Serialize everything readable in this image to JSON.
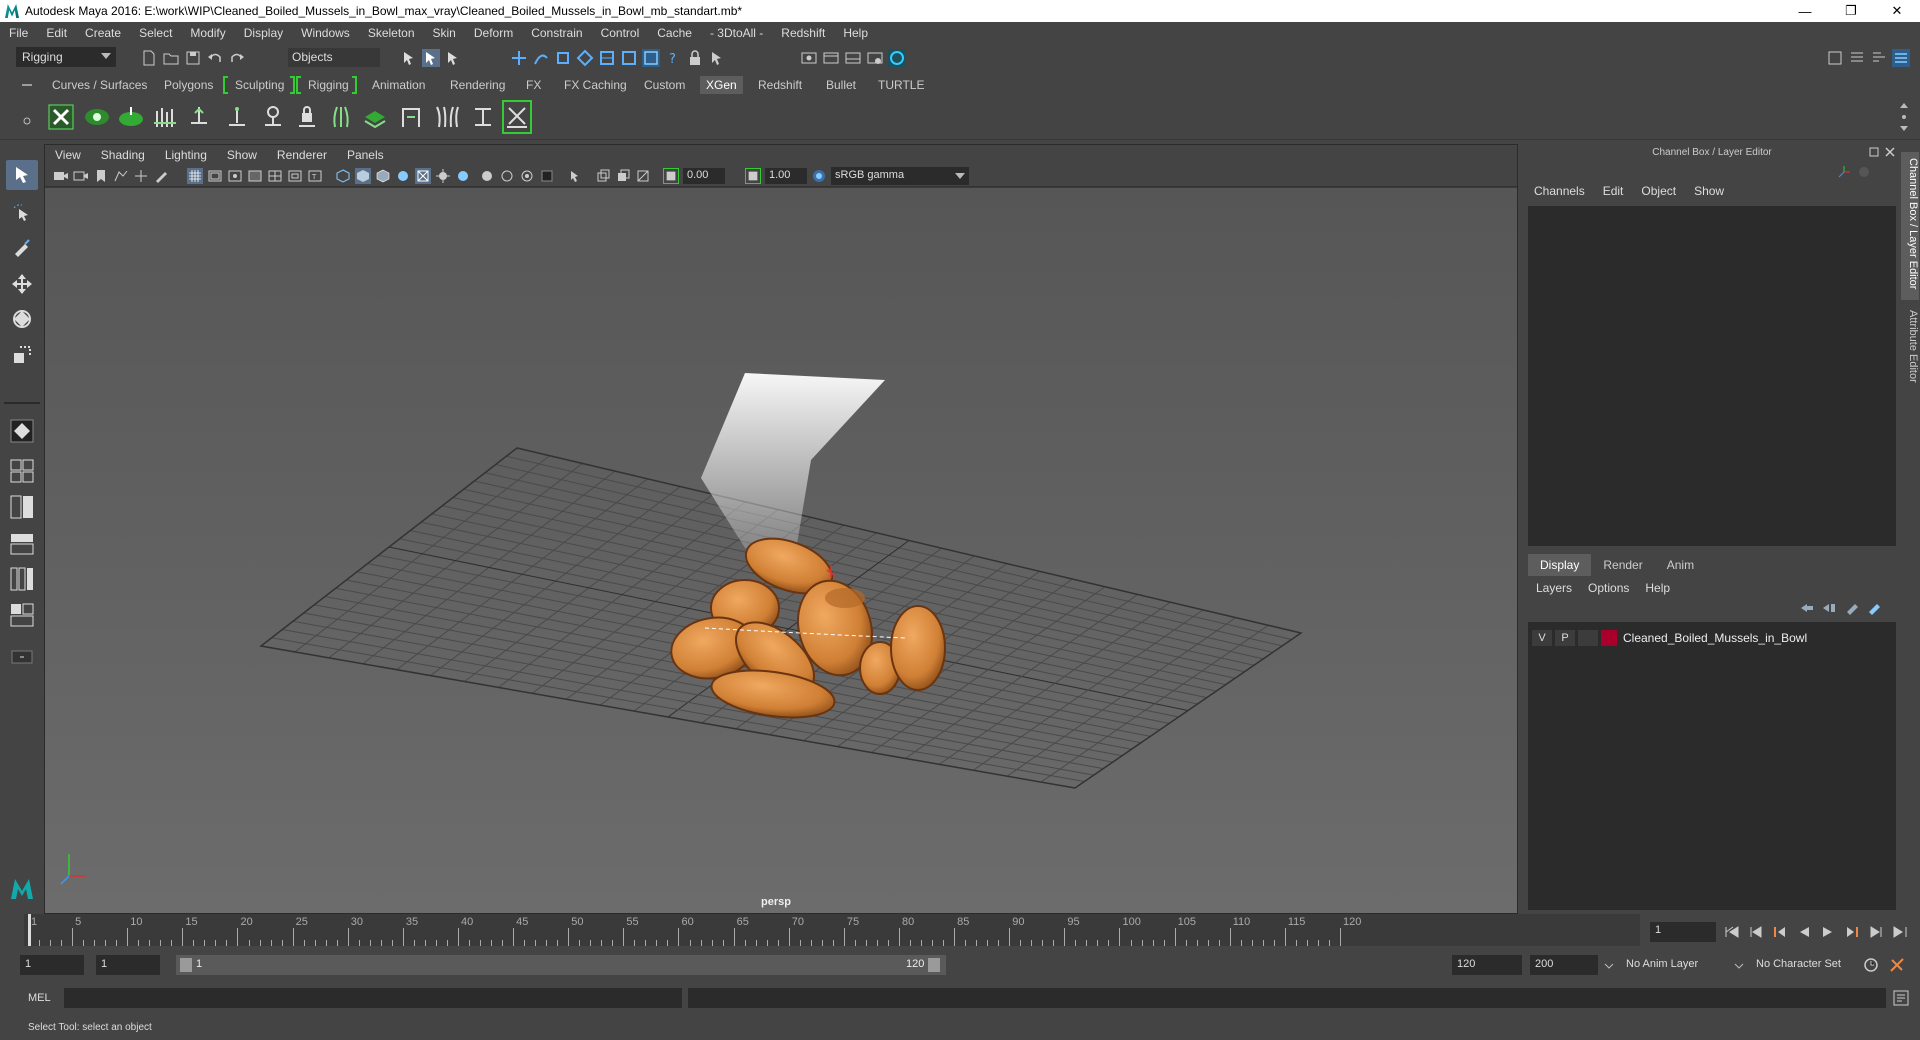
{
  "window": {
    "title": "Autodesk Maya 2016: E:\\work\\WIP\\Cleaned_Boiled_Mussels_in_Bowl_max_vray\\Cleaned_Boiled_Mussels_in_Bowl_mb_standart.mb*",
    "minimize": "—",
    "restore": "❐",
    "close": "✕"
  },
  "menubar": [
    "File",
    "Edit",
    "Create",
    "Select",
    "Modify",
    "Display",
    "Windows",
    "Skeleton",
    "Skin",
    "Deform",
    "Constrain",
    "Control",
    "Cache",
    "- 3DtoAll -",
    "Redshift",
    "Help"
  ],
  "statusline": {
    "mode": "Rigging",
    "selection_mode": "Objects"
  },
  "shelf_tabs": [
    "Curves / Surfaces",
    "Polygons",
    "Sculpting",
    "Rigging",
    "Animation",
    "Rendering",
    "FX",
    "FX Caching",
    "Custom",
    "XGen",
    "Redshift",
    "Bullet",
    "TURTLE"
  ],
  "active_shelf_tab": "XGen",
  "viewport": {
    "menu": [
      "View",
      "Shading",
      "Lighting",
      "Show",
      "Renderer",
      "Panels"
    ],
    "exposure": "0.00",
    "gamma": "1.00",
    "color_space": "sRGB gamma",
    "camera": "persp"
  },
  "channel_box": {
    "header": "Channel Box / Layer Editor",
    "menu": [
      "Channels",
      "Edit",
      "Object",
      "Show"
    ]
  },
  "layer_editor": {
    "tabs": [
      "Display",
      "Render",
      "Anim"
    ],
    "active_tab": "Display",
    "menu": [
      "Layers",
      "Options",
      "Help"
    ],
    "layers": [
      {
        "v": "V",
        "p": "P",
        "name": "Cleaned_Boiled_Mussels_in_Bowl",
        "color": "#a8002a"
      }
    ]
  },
  "side_tabs": [
    "Channel Box / Layer Editor",
    "Attribute Editor"
  ],
  "timeline": {
    "ticks": [
      "1",
      "5",
      "10",
      "15",
      "20",
      "25",
      "30",
      "35",
      "40",
      "45",
      "50",
      "55",
      "60",
      "65",
      "70",
      "75",
      "80",
      "85",
      "90",
      "95",
      "100",
      "105",
      "110",
      "115",
      "120"
    ],
    "current_frame": "1"
  },
  "range": {
    "start_time": "1",
    "playback_start": "1",
    "range_start_label": "1",
    "range_end_label": "120",
    "playback_end": "120",
    "end_time": "200",
    "anim_layer": "No Anim Layer",
    "character_set": "No Character Set"
  },
  "command_line": {
    "language": "MEL"
  },
  "help_line": "Select Tool: select an object",
  "colors": {
    "accent": "#5d5d5d",
    "bracket": "#33cc33",
    "layer_color": "#a8002a",
    "mussel": "#d88a3c"
  }
}
